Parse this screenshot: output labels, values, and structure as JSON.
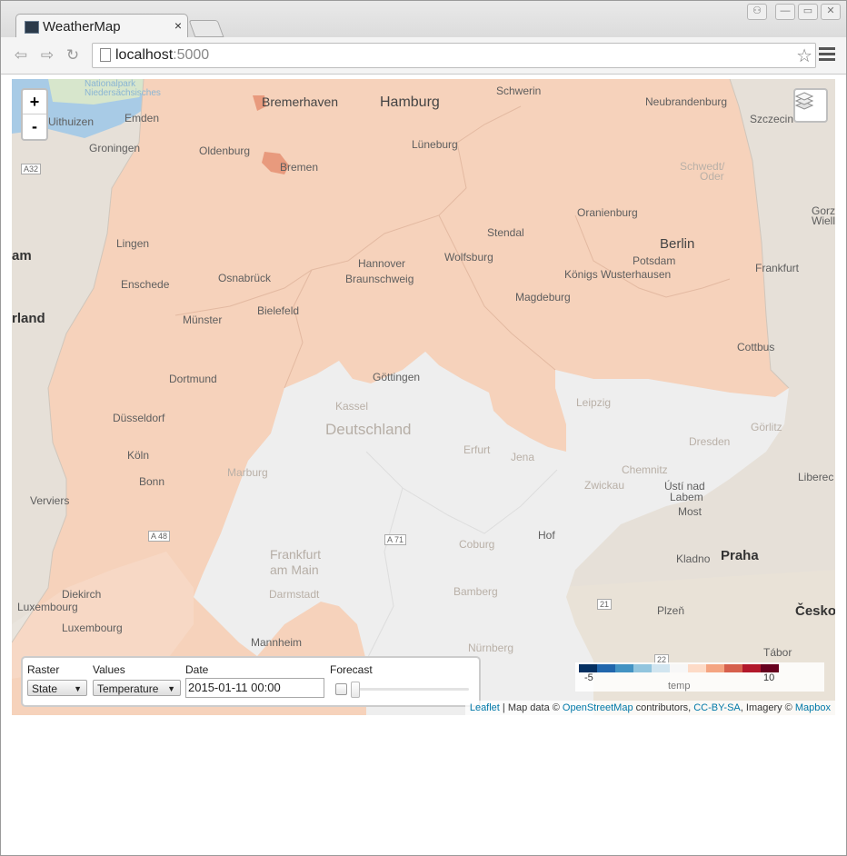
{
  "browser": {
    "tab_title": "WeatherMap",
    "tab_close": "×",
    "url_host": "localhost",
    "url_port": ":5000",
    "bookmark_star": "☆",
    "nav_back": "⇦",
    "nav_forward": "⇨",
    "nav_reload": "↻",
    "window_buttons": {
      "user": "⚇",
      "minimize": "—",
      "maximize": "▭",
      "close": "✕"
    }
  },
  "map": {
    "zoom_in": "+",
    "zoom_out": "-",
    "labels": {
      "bremerhaven": "Bremerhaven",
      "hamburg": "Hamburg",
      "schwerin": "Schwerin",
      "neubrandenburg": "Neubrandenburg",
      "szczecin": "Szczecin",
      "emden": "Emden",
      "uithuizen": "Uithuizen",
      "groningen": "Groningen",
      "oldenburg": "Oldenburg",
      "bremen": "Bremen",
      "luneburg": "Lüneburg",
      "schwedt": "Schwedt/",
      "oder": "Oder",
      "oranienburg": "Oranienburg",
      "gorz": "Gorz",
      "wiell": "Wiell",
      "stendal": "Stendal",
      "berlin": "Berlin",
      "lingen": "Lingen",
      "am": "am",
      "hannover": "Hannover",
      "wolfsburg": "Wolfsburg",
      "potsdam": "Potsdam",
      "frankfurt_oder": "Frankfurt",
      "osnabruck": "Osnabrück",
      "braunschweig": "Braunschweig",
      "konigs": "Königs Wusterhausen",
      "enschede": "Enschede",
      "magdeburg": "Magdeburg",
      "rland": "rland",
      "munster": "Münster",
      "bielefeld": "Bielefeld",
      "cottbus": "Cottbus",
      "dortmund": "Dortmund",
      "gottingen": "Göttingen",
      "kassel": "Kassel",
      "leipzig": "Leipzig",
      "deutschland": "Deutschland",
      "dusseldorf": "Düsseldorf",
      "gorlitz": "Görlitz",
      "dresden": "Dresden",
      "erfurt": "Erfurt",
      "jena": "Jena",
      "koln": "Köln",
      "marburg": "Marburg",
      "chemnitz": "Chemnitz",
      "liberec": "Liberec",
      "bonn": "Bonn",
      "zwickau": "Zwickau",
      "usti": "Ústí nad",
      "labem": "Labem",
      "verviers": "Verviers",
      "most": "Most",
      "frankfurt_main": "Frankfurt",
      "am_main": "am Main",
      "coburg": "Coburg",
      "hof": "Hof",
      "kladno": "Kladno",
      "praha": "Praha",
      "darmstadt": "Darmstadt",
      "bamberg": "Bamberg",
      "diekirch": "Diekirch",
      "luxembourg": "Luxembourg",
      "plzen": "Plzeň",
      "cesko": "Česko",
      "luxembourg2": "Luxembourg",
      "mannheim": "Mannheim",
      "nurnberg": "Nürnberg",
      "tabor": "Tábor",
      "nationalpark": "Nationalpark",
      "niedersachsisches": "Niedersächsisches",
      "wattenmeer": "Wattenmeer",
      "a32": "A32",
      "a2": "A2",
      "a48": "A 48",
      "a71": "A 71",
      "r21": "21",
      "r22": "22"
    }
  },
  "controls": {
    "raster_label": "Raster",
    "raster_value": "State",
    "values_label": "Values",
    "values_value": "Temperature",
    "date_label": "Date",
    "date_value": "2015-01-11 00:00",
    "forecast_label": "Forecast",
    "forecast_checked": false,
    "forecast_slider_position": 0
  },
  "legend": {
    "title": "temp",
    "min": "-5",
    "max": "10",
    "colors": [
      "#053061",
      "#2166ac",
      "#4393c3",
      "#92c5de",
      "#d1e5f0",
      "#f7f7f7",
      "#fddbc7",
      "#f4a582",
      "#d6604d",
      "#b2182b",
      "#67001f"
    ]
  },
  "attribution": {
    "leaflet": "Leaflet",
    "sep": " | Map data © ",
    "osm": "OpenStreetMap",
    "contributors": " contributors, ",
    "ccbysa": "CC-BY-SA",
    "imagery": ", Imagery © ",
    "mapbox": "Mapbox"
  },
  "colors": {
    "north_fill": "#f6d2bb",
    "central_fill": "#eeeeee",
    "south_fill": "#f5c9ad",
    "bremen_fill": "#e89a7d"
  }
}
